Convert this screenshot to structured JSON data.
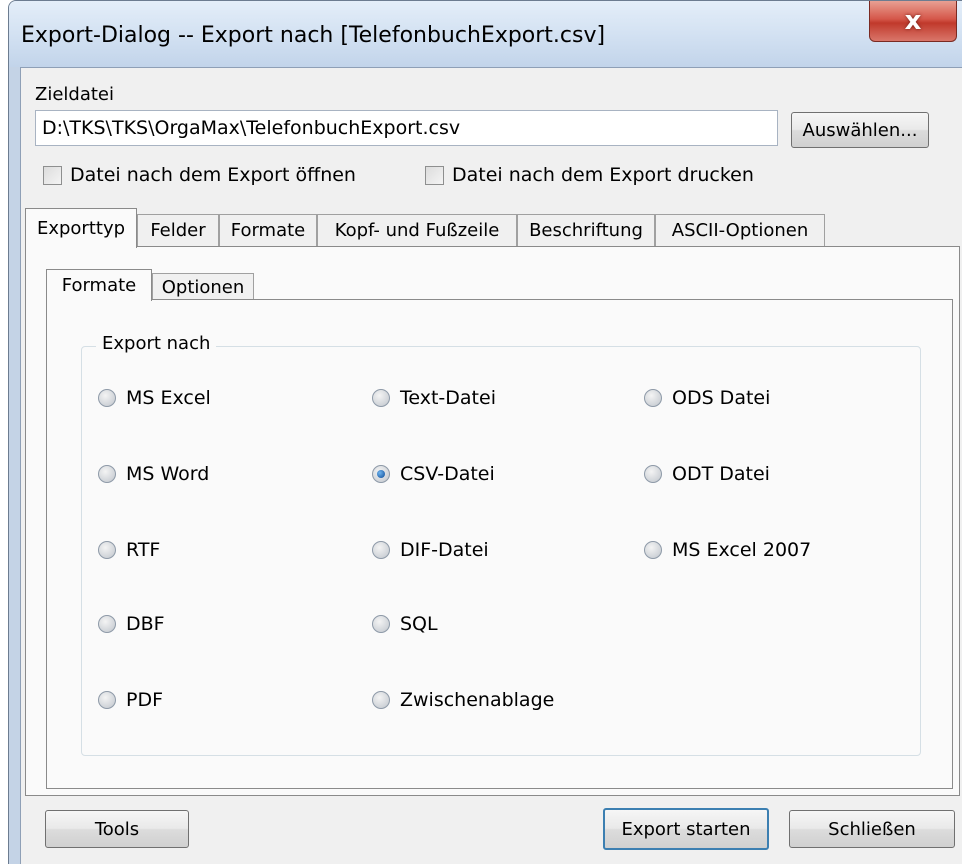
{
  "window": {
    "title": "Export-Dialog -- Export nach [TelefonbuchExport.csv]",
    "close_glyph": "x"
  },
  "target": {
    "label": "Zieldatei",
    "path_value": "D:\\TKS\\TKS\\OrgaMax\\TelefonbuchExport.csv",
    "select_button": "Auswählen..."
  },
  "options": {
    "open_after": "Datei nach dem Export öffnen",
    "open_after_checked": false,
    "print_after": "Datei nach dem Export drucken",
    "print_after_checked": false
  },
  "tabs": [
    {
      "label": "Exporttyp",
      "active": true
    },
    {
      "label": "Felder",
      "active": false
    },
    {
      "label": "Formate",
      "active": false
    },
    {
      "label": "Kopf- und Fußzeile",
      "active": false
    },
    {
      "label": "Beschriftung",
      "active": false
    },
    {
      "label": "ASCII-Optionen",
      "active": false
    }
  ],
  "inner_tabs": [
    {
      "label": "Formate",
      "active": true
    },
    {
      "label": "Optionen",
      "active": false
    }
  ],
  "export_group": {
    "label": "Export nach",
    "selected": "CSV-Datei",
    "formats": [
      "MS Excel",
      "Text-Datei",
      "ODS Datei",
      "MS Word",
      "CSV-Datei",
      "ODT Datei",
      "RTF",
      "DIF-Datei",
      "MS Excel 2007",
      "DBF",
      "SQL",
      "PDF",
      "Zwischenablage"
    ]
  },
  "footer": {
    "tools": "Tools",
    "export": "Export starten",
    "close": "Schließen"
  }
}
